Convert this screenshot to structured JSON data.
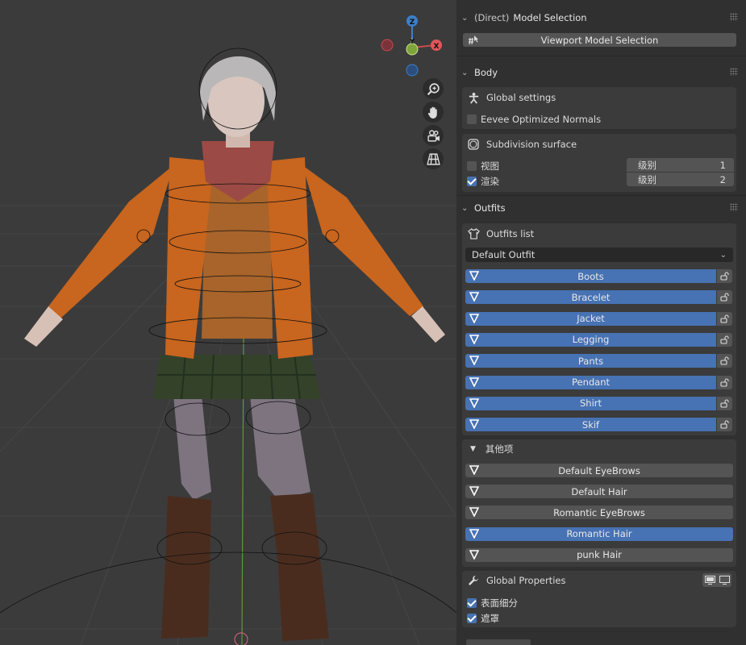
{
  "model_selection": {
    "header_prefix": "(Direct)",
    "header_title": "Model Selection",
    "button_label": "Viewport Model Selection"
  },
  "body": {
    "header": "Body",
    "global_settings_label": "Global settings",
    "eevee_label": "Eevee Optimized Normals",
    "eevee_checked": false,
    "subdivision_label": "Subdivision surface",
    "view_label": "视图",
    "view_checked": false,
    "render_label": "渲染",
    "render_checked": true,
    "level_label": "级别",
    "view_level": "1",
    "render_level": "2"
  },
  "outfits": {
    "header": "Outfits",
    "list_label": "Outfits list",
    "selected_outfit": "Default Outfit",
    "items": [
      "Boots",
      "Bracelet",
      "Jacket",
      "Legging",
      "Pants",
      "Pendant",
      "Shirt",
      "Skif"
    ]
  },
  "others": {
    "header": "其他项",
    "items": [
      {
        "label": "Default EyeBrows",
        "active": false
      },
      {
        "label": "Default Hair",
        "active": false
      },
      {
        "label": "Romantic EyeBrows",
        "active": false
      },
      {
        "label": "Romantic Hair",
        "active": true
      },
      {
        "label": "punk Hair",
        "active": false
      }
    ]
  },
  "global_properties": {
    "header": "Global Properties",
    "subsurf_label": "表面细分",
    "subsurf_checked": true,
    "mask_label": "遮罩",
    "mask_checked": true
  },
  "gizmo": {
    "z_label": "Z",
    "y_label": "Y",
    "x_label": "X"
  },
  "colors": {
    "accent_blue": "#4772b3",
    "panel_bg": "#303030",
    "box_bg": "#3b3b3b",
    "button_grey": "#545454"
  }
}
